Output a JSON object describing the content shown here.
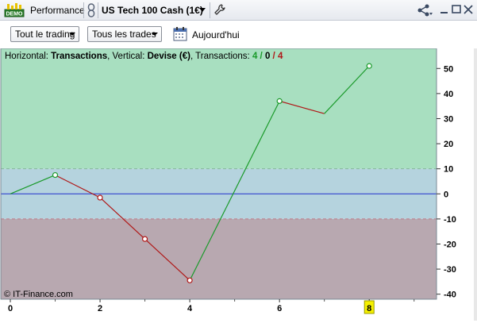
{
  "window": {
    "badge": "DEMO",
    "tab_title": "Performance",
    "instrument_label": "US Tech 100 Cash (1€)",
    "icons": [
      "demo-badge-icon",
      "link-icon",
      "chevron-down-icon",
      "wrench-icon",
      "share-icon",
      "minimize-icon",
      "maximize-icon",
      "close-icon"
    ]
  },
  "toolbar": {
    "trading_filter": "Tout le trading",
    "trades_filter": "Tous les trades",
    "today_label": "Aujourd'hui",
    "calendar_icon": "calendar-icon"
  },
  "chart_info": {
    "horizontal_prefix": "Horizontal: ",
    "horizontal_value": "Transactions",
    "vertical_prefix": ", Vertical: ",
    "vertical_value": "Devise (€)",
    "transactions_prefix": ", Transactions: ",
    "transactions_win": "4",
    "slash1": " / ",
    "transactions_neutral": "0",
    "slash2": " / ",
    "transactions_loss": "4"
  },
  "watermark": "© IT-Finance.com",
  "colors": {
    "upper_zone": "#a8dfc0",
    "neutral_zone": "#b5d3de",
    "lower_zone": "#b8a8b0",
    "gain_line": "#1a9a2a",
    "loss_line": "#b01818",
    "zero_line": "#2233cc",
    "win_count": "#1a9a2a",
    "loss_count": "#b01818",
    "highlight_tick": "#f5f000"
  },
  "chart_data": {
    "type": "line",
    "x": [
      0,
      1,
      2,
      3,
      4,
      5,
      6,
      7,
      8
    ],
    "y": [
      0,
      7.5,
      -1.5,
      -18,
      -34.5,
      null,
      37,
      32,
      51
    ],
    "series": [
      {
        "points": [
          [
            0,
            0
          ],
          [
            1,
            7.5
          ]
        ],
        "color_key": "gain_line"
      },
      {
        "points": [
          [
            1,
            7.5
          ],
          [
            2,
            -1.5
          ],
          [
            3,
            -18
          ],
          [
            4,
            -34.5
          ]
        ],
        "color_key": "loss_line"
      },
      {
        "points": [
          [
            4,
            -34.5
          ],
          [
            6,
            37
          ]
        ],
        "color_key": "gain_line"
      },
      {
        "points": [
          [
            6,
            37
          ],
          [
            7,
            32
          ]
        ],
        "color_key": "loss_line"
      },
      {
        "points": [
          [
            7,
            32
          ],
          [
            8,
            51
          ]
        ],
        "color_key": "gain_line"
      }
    ],
    "markers": [
      {
        "x": 1,
        "y": 7.5,
        "color_key": "gain_line"
      },
      {
        "x": 2,
        "y": -1.5,
        "color_key": "loss_line"
      },
      {
        "x": 3,
        "y": -18,
        "color_key": "loss_line"
      },
      {
        "x": 4,
        "y": -34.5,
        "color_key": "loss_line"
      },
      {
        "x": 6,
        "y": 37,
        "color_key": "gain_line"
      },
      {
        "x": 8,
        "y": 51,
        "color_key": "gain_line"
      }
    ],
    "xticks": [
      "0",
      "2",
      "4",
      "6",
      "8"
    ],
    "xtick_values": [
      0,
      2,
      4,
      6,
      8
    ],
    "highlighted_xtick": "8",
    "yticks": [
      "50",
      "40",
      "30",
      "20",
      "10",
      "0",
      "-10",
      "-20",
      "-30",
      "-40"
    ],
    "ytick_values": [
      50,
      40,
      30,
      20,
      10,
      0,
      -10,
      -20,
      -30,
      -40
    ],
    "xlim": [
      0,
      9.5
    ],
    "ylim": [
      -42,
      58
    ],
    "upper_threshold": 10,
    "lower_threshold": -10,
    "grid": false,
    "xlabel": "",
    "ylabel": ""
  }
}
